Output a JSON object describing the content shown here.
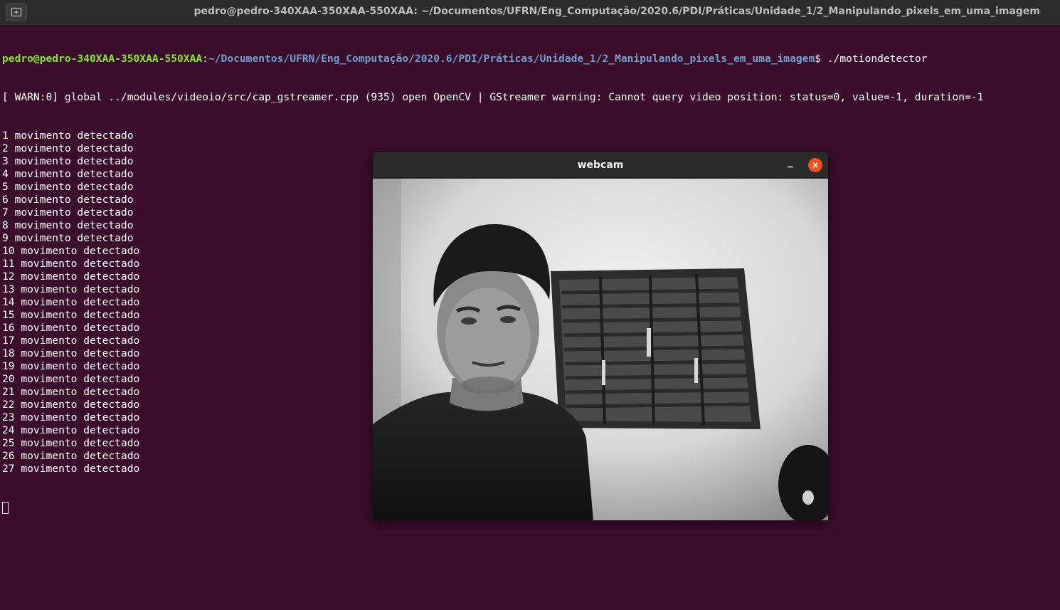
{
  "titlebar": {
    "title": "pedro@pedro-340XAA-350XAA-550XAA: ~/Documentos/UFRN/Eng_Computação/2020.6/PDI/Práticas/Unidade_1/2_Manipulando_pixels_em_uma_imagem",
    "new_tab_icon": "new-tab-icon"
  },
  "terminal": {
    "prompt_user": "pedro@pedro-340XAA-350XAA-550XAA",
    "prompt_sep": ":",
    "prompt_path": "~/Documentos/UFRN/Eng_Computação/2020.6/PDI/Práticas/Unidade_1/2_Manipulando_pixels_em_uma_imagem",
    "prompt_symbol": "$ ",
    "command": "./motiondetector",
    "warning": "[ WARN:0] global ../modules/videoio/src/cap_gstreamer.cpp (935) open OpenCV | GStreamer warning: Cannot query video position: status=0, value=-1, duration=-1",
    "output_lines": [
      "1 movimento detectado",
      "2 movimento detectado",
      "3 movimento detectado",
      "4 movimento detectado",
      "5 movimento detectado",
      "6 movimento detectado",
      "7 movimento detectado",
      "8 movimento detectado",
      "9 movimento detectado",
      "10 movimento detectado",
      "11 movimento detectado",
      "12 movimento detectado",
      "13 movimento detectado",
      "14 movimento detectado",
      "15 movimento detectado",
      "16 movimento detectado",
      "17 movimento detectado",
      "18 movimento detectado",
      "19 movimento detectado",
      "20 movimento detectado",
      "21 movimento detectado",
      "22 movimento detectado",
      "23 movimento detectado",
      "24 movimento detectado",
      "25 movimento detectado",
      "26 movimento detectado",
      "27 movimento detectado"
    ]
  },
  "webcam": {
    "title": "webcam",
    "minimize_icon": "minimize-icon",
    "close_icon": "close-icon"
  },
  "colors": {
    "terminal_bg": "#3b0f2c",
    "prompt_user": "#8ae234",
    "prompt_path": "#729fcf",
    "close_button": "#e9541f"
  }
}
